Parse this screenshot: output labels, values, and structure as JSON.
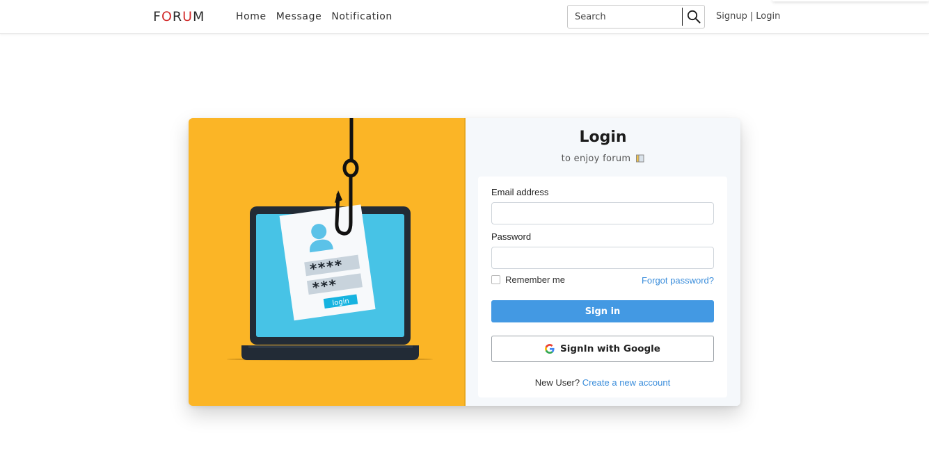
{
  "navbar": {
    "brand": {
      "part1": "F",
      "part2": "O",
      "part3": "R",
      "part4": "U",
      "part5": "M"
    },
    "links": [
      "Home",
      "Message",
      "Notification"
    ],
    "search": {
      "placeholder": "Search"
    },
    "auth": {
      "signup": "Signup",
      "separator": "|",
      "login": "Login"
    }
  },
  "illustration": {
    "stars_row1": "****",
    "stars_row2": "***",
    "button_text": "login"
  },
  "login_form": {
    "title": "Login",
    "subtitle": "to enjoy forum",
    "email_label": "Email address",
    "email_value": "",
    "password_label": "Password",
    "password_value": "",
    "remember_label": "Remember me",
    "remember_checked": false,
    "forgot_link": "Forgot password?",
    "signin_button": "Sign in",
    "google_button": "SignIn with Google",
    "new_user_text": "New User?",
    "create_account_link": "Create a new account"
  },
  "colors": {
    "accent_blue": "#4399e3",
    "link_blue": "#3a8ddb",
    "illustration_bg": "#fbb526",
    "brand_red": "#d32f2f"
  }
}
